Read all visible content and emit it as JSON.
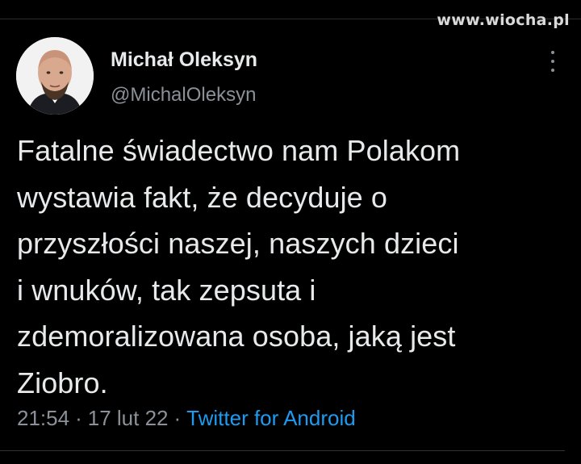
{
  "watermark": "www.wiocha.pl",
  "tweet": {
    "author_name": "Michał Oleksyn",
    "author_handle": "@MichalOleksyn",
    "text": "Fatalne świadectwo nam Polakom\nwystawia fakt, że decyduje o\nprzyszłości naszej, naszych dzieci\ni wnuków, tak zepsuta i\nzdemoralizowana  osoba, jaką jest\nZiobro.",
    "time": "21:54",
    "date": "17 lut 22",
    "separator": "·",
    "source": "Twitter for Android"
  },
  "icons": {
    "more": "more-vertical-icon",
    "avatar": "avatar"
  },
  "colors": {
    "background": "#000000",
    "text": "#e7e9ea",
    "secondary": "#8b9198",
    "link": "#1d9bf0"
  }
}
